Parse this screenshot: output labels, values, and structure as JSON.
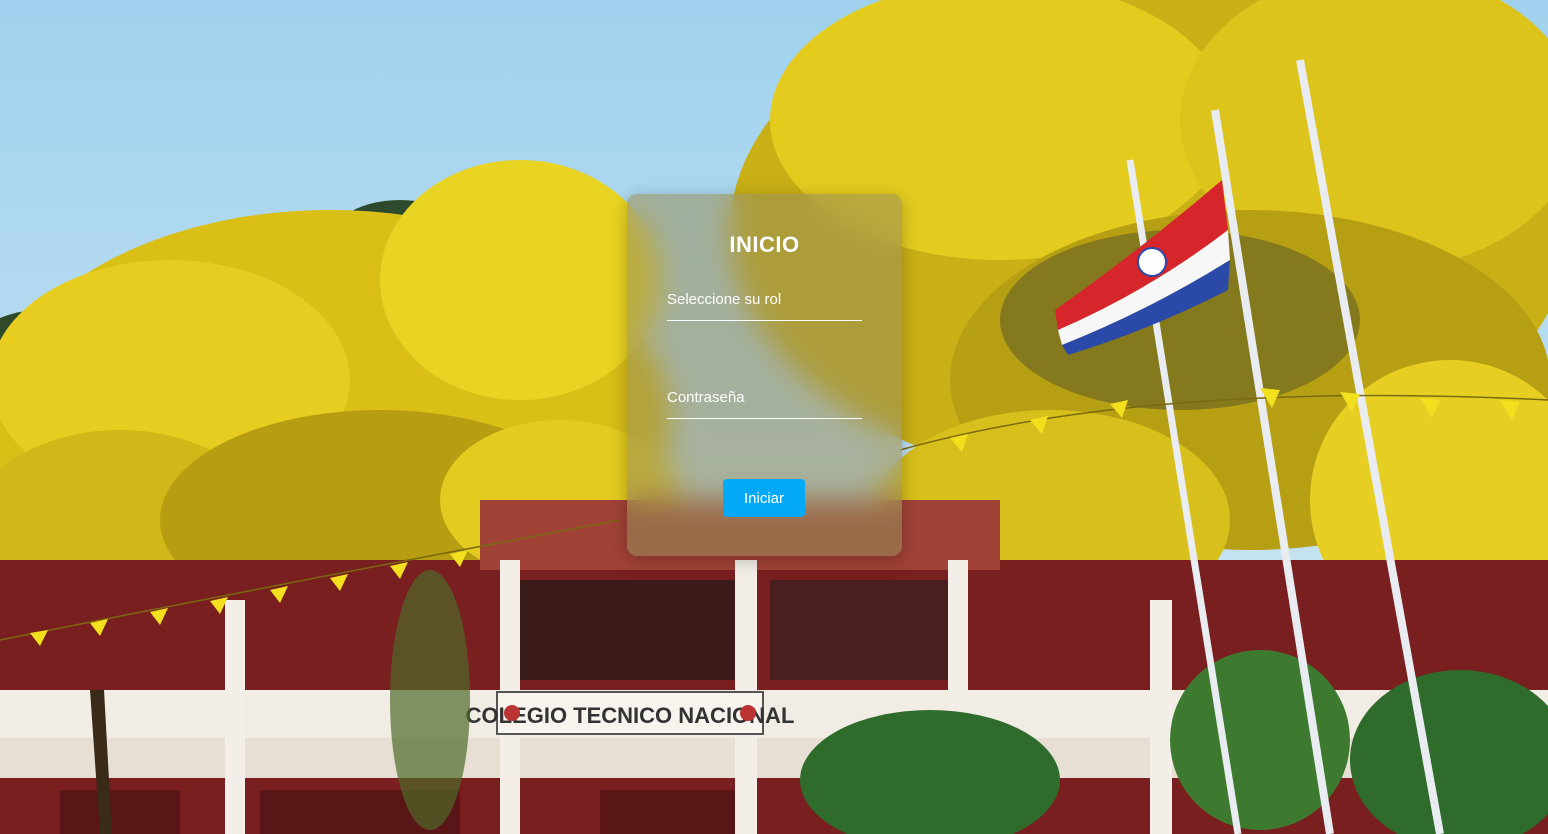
{
  "login": {
    "title": "INICIO",
    "role_label": "Seleccione su rol",
    "password_label": "Contraseña",
    "submit_label": "Iniciar"
  },
  "background": {
    "sign_text": "COLEGIO TECNICO NACIONAL"
  },
  "colors": {
    "accent": "#03a9f4",
    "sky": "#a9d6ef",
    "foliage": "#e8d21e",
    "building_red": "#7a1f1f"
  }
}
